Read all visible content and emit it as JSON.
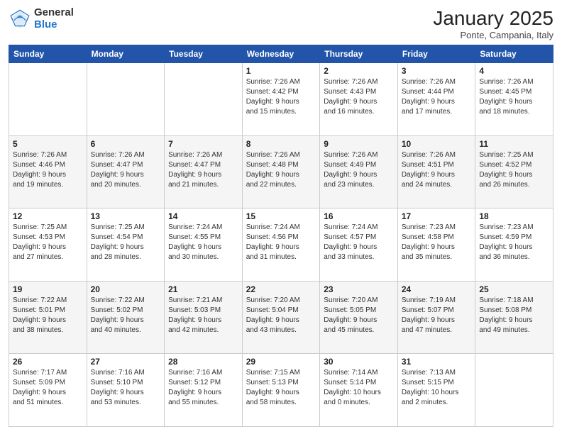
{
  "header": {
    "logo_general": "General",
    "logo_blue": "Blue",
    "month": "January 2025",
    "location": "Ponte, Campania, Italy"
  },
  "days_of_week": [
    "Sunday",
    "Monday",
    "Tuesday",
    "Wednesday",
    "Thursday",
    "Friday",
    "Saturday"
  ],
  "weeks": [
    [
      {
        "day": "",
        "info": ""
      },
      {
        "day": "",
        "info": ""
      },
      {
        "day": "",
        "info": ""
      },
      {
        "day": "1",
        "info": "Sunrise: 7:26 AM\nSunset: 4:42 PM\nDaylight: 9 hours\nand 15 minutes."
      },
      {
        "day": "2",
        "info": "Sunrise: 7:26 AM\nSunset: 4:43 PM\nDaylight: 9 hours\nand 16 minutes."
      },
      {
        "day": "3",
        "info": "Sunrise: 7:26 AM\nSunset: 4:44 PM\nDaylight: 9 hours\nand 17 minutes."
      },
      {
        "day": "4",
        "info": "Sunrise: 7:26 AM\nSunset: 4:45 PM\nDaylight: 9 hours\nand 18 minutes."
      }
    ],
    [
      {
        "day": "5",
        "info": "Sunrise: 7:26 AM\nSunset: 4:46 PM\nDaylight: 9 hours\nand 19 minutes."
      },
      {
        "day": "6",
        "info": "Sunrise: 7:26 AM\nSunset: 4:47 PM\nDaylight: 9 hours\nand 20 minutes."
      },
      {
        "day": "7",
        "info": "Sunrise: 7:26 AM\nSunset: 4:47 PM\nDaylight: 9 hours\nand 21 minutes."
      },
      {
        "day": "8",
        "info": "Sunrise: 7:26 AM\nSunset: 4:48 PM\nDaylight: 9 hours\nand 22 minutes."
      },
      {
        "day": "9",
        "info": "Sunrise: 7:26 AM\nSunset: 4:49 PM\nDaylight: 9 hours\nand 23 minutes."
      },
      {
        "day": "10",
        "info": "Sunrise: 7:26 AM\nSunset: 4:51 PM\nDaylight: 9 hours\nand 24 minutes."
      },
      {
        "day": "11",
        "info": "Sunrise: 7:25 AM\nSunset: 4:52 PM\nDaylight: 9 hours\nand 26 minutes."
      }
    ],
    [
      {
        "day": "12",
        "info": "Sunrise: 7:25 AM\nSunset: 4:53 PM\nDaylight: 9 hours\nand 27 minutes."
      },
      {
        "day": "13",
        "info": "Sunrise: 7:25 AM\nSunset: 4:54 PM\nDaylight: 9 hours\nand 28 minutes."
      },
      {
        "day": "14",
        "info": "Sunrise: 7:24 AM\nSunset: 4:55 PM\nDaylight: 9 hours\nand 30 minutes."
      },
      {
        "day": "15",
        "info": "Sunrise: 7:24 AM\nSunset: 4:56 PM\nDaylight: 9 hours\nand 31 minutes."
      },
      {
        "day": "16",
        "info": "Sunrise: 7:24 AM\nSunset: 4:57 PM\nDaylight: 9 hours\nand 33 minutes."
      },
      {
        "day": "17",
        "info": "Sunrise: 7:23 AM\nSunset: 4:58 PM\nDaylight: 9 hours\nand 35 minutes."
      },
      {
        "day": "18",
        "info": "Sunrise: 7:23 AM\nSunset: 4:59 PM\nDaylight: 9 hours\nand 36 minutes."
      }
    ],
    [
      {
        "day": "19",
        "info": "Sunrise: 7:22 AM\nSunset: 5:01 PM\nDaylight: 9 hours\nand 38 minutes."
      },
      {
        "day": "20",
        "info": "Sunrise: 7:22 AM\nSunset: 5:02 PM\nDaylight: 9 hours\nand 40 minutes."
      },
      {
        "day": "21",
        "info": "Sunrise: 7:21 AM\nSunset: 5:03 PM\nDaylight: 9 hours\nand 42 minutes."
      },
      {
        "day": "22",
        "info": "Sunrise: 7:20 AM\nSunset: 5:04 PM\nDaylight: 9 hours\nand 43 minutes."
      },
      {
        "day": "23",
        "info": "Sunrise: 7:20 AM\nSunset: 5:05 PM\nDaylight: 9 hours\nand 45 minutes."
      },
      {
        "day": "24",
        "info": "Sunrise: 7:19 AM\nSunset: 5:07 PM\nDaylight: 9 hours\nand 47 minutes."
      },
      {
        "day": "25",
        "info": "Sunrise: 7:18 AM\nSunset: 5:08 PM\nDaylight: 9 hours\nand 49 minutes."
      }
    ],
    [
      {
        "day": "26",
        "info": "Sunrise: 7:17 AM\nSunset: 5:09 PM\nDaylight: 9 hours\nand 51 minutes."
      },
      {
        "day": "27",
        "info": "Sunrise: 7:16 AM\nSunset: 5:10 PM\nDaylight: 9 hours\nand 53 minutes."
      },
      {
        "day": "28",
        "info": "Sunrise: 7:16 AM\nSunset: 5:12 PM\nDaylight: 9 hours\nand 55 minutes."
      },
      {
        "day": "29",
        "info": "Sunrise: 7:15 AM\nSunset: 5:13 PM\nDaylight: 9 hours\nand 58 minutes."
      },
      {
        "day": "30",
        "info": "Sunrise: 7:14 AM\nSunset: 5:14 PM\nDaylight: 10 hours\nand 0 minutes."
      },
      {
        "day": "31",
        "info": "Sunrise: 7:13 AM\nSunset: 5:15 PM\nDaylight: 10 hours\nand 2 minutes."
      },
      {
        "day": "",
        "info": ""
      }
    ]
  ]
}
